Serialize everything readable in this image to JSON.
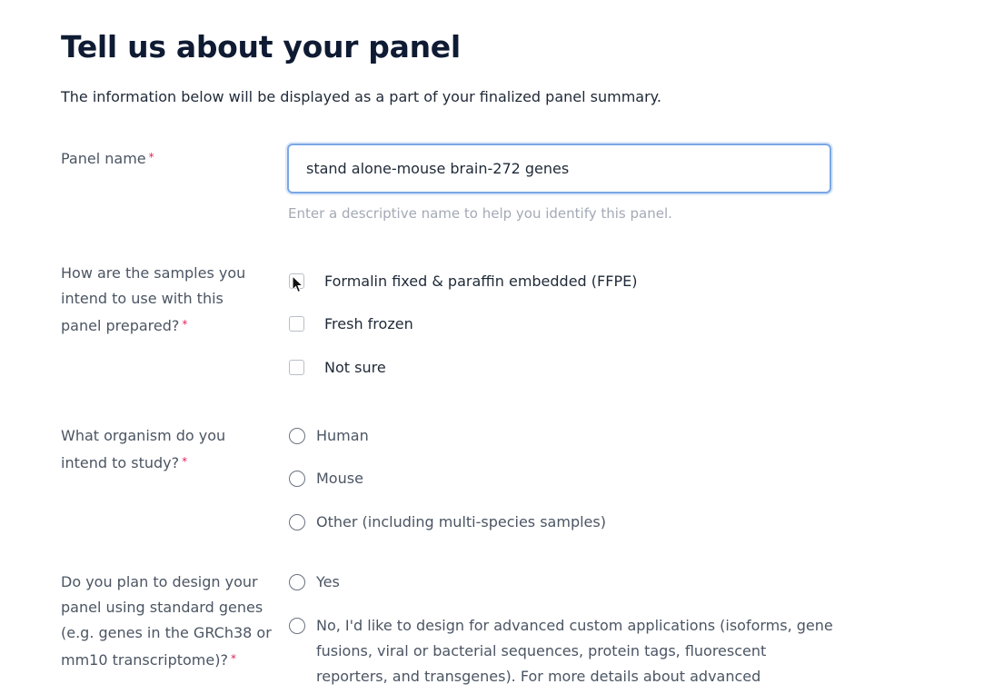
{
  "heading": "Tell us about your panel",
  "intro": "The information below will be displayed as a part of your finalized panel summary.",
  "required_marker": "*",
  "panel_name": {
    "label": "Panel name",
    "value": "stand alone-mouse brain-272 genes",
    "helper": "Enter a descriptive name to help you identify this panel."
  },
  "sample_prep": {
    "label": "How are the samples you intend to use with this panel prepared?",
    "options": [
      "Formalin fixed & paraffin embedded (FFPE)",
      "Fresh frozen",
      "Not sure"
    ]
  },
  "organism": {
    "label": "What organism do you intend to study?",
    "options": [
      "Human",
      "Mouse",
      "Other (including multi-species samples)"
    ]
  },
  "design": {
    "label": "Do you plan to design your panel using standard genes (e.g. genes in the GRCh38 or mm10 transcriptome)?",
    "options": [
      "Yes",
      "No, I'd like to design for advanced custom applications (isoforms, gene fusions, viral or bacterial sequences, protein tags, fluorescent reporters, and transgenes). For more details about advanced"
    ]
  },
  "colors": {
    "input_border": "#7aa7e6",
    "required": "#e0245e",
    "heading": "#0f1b33"
  }
}
